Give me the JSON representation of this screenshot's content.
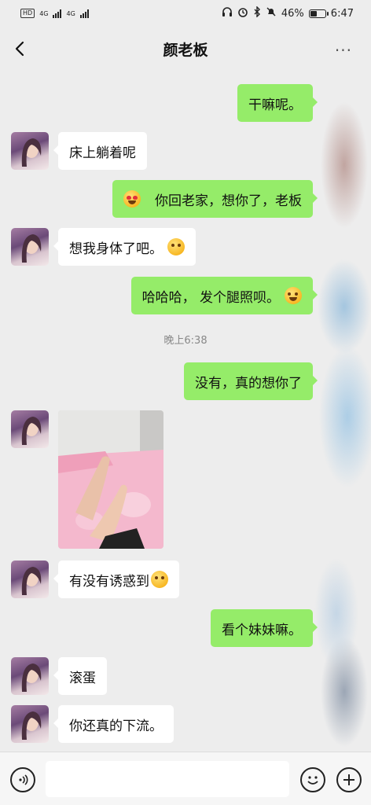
{
  "status_bar": {
    "left_chip": "HD",
    "network_1": "4G",
    "network_2": "4G",
    "battery_text": "46%",
    "battery_level": 0.46,
    "time": "6:47"
  },
  "header": {
    "title": "颜老板",
    "more_label": "···"
  },
  "messages": [
    {
      "dir": "out",
      "text": "干嘛呢。"
    },
    {
      "dir": "in",
      "text": "床上躺着呢"
    },
    {
      "dir": "out",
      "emoji_lead": "heart-eyes-emoji",
      "text": "你回老家，想你了，老板"
    },
    {
      "dir": "in",
      "text": "想我身体了吧。",
      "emoji_trail": "thinking-emoji"
    },
    {
      "dir": "out",
      "text": "哈哈哈，  发个腿照呗。",
      "emoji_trail": "laughing-emoji"
    },
    {
      "type": "time",
      "text": "晚上6:38"
    },
    {
      "dir": "out",
      "text": "没有，真的想你了"
    },
    {
      "dir": "in",
      "type": "photo",
      "alt": "photo-message"
    },
    {
      "dir": "in",
      "text": "有没有诱惑到",
      "emoji_trail": "thinking-emoji"
    },
    {
      "dir": "out",
      "text": "看个妹妹嘛。"
    },
    {
      "dir": "in",
      "text": "滚蛋"
    },
    {
      "dir": "in",
      "text": "你还真的下流。"
    }
  ],
  "input": {
    "value": "",
    "placeholder": ""
  },
  "colors": {
    "background": "#ededed",
    "outgoing_bubble": "#95ec69",
    "incoming_bubble": "#ffffff"
  }
}
